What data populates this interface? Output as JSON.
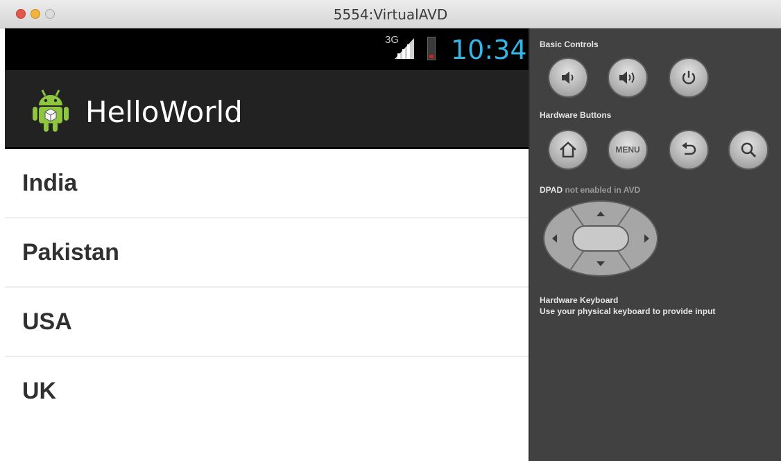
{
  "window": {
    "title": "5554:VirtualAVD"
  },
  "status_bar": {
    "network": "3G",
    "time": "10:34",
    "time_color": "#33b5e5",
    "battery_level": 0.15
  },
  "action_bar": {
    "app_title": "HelloWorld",
    "icon": "android-robot-icon"
  },
  "list": {
    "items": [
      "India",
      "Pakistan",
      "USA",
      "UK"
    ]
  },
  "controls": {
    "basic_label": "Basic Controls",
    "basic_buttons": [
      "volume-down-icon",
      "volume-up-icon",
      "power-icon"
    ],
    "hardware_label": "Hardware Buttons",
    "hardware_buttons": [
      "home-icon",
      "menu",
      "back-icon",
      "search-icon"
    ],
    "menu_label": "MENU",
    "dpad_label_strong": "DPAD",
    "dpad_label_dim": "not enabled in AVD",
    "keyboard_title": "Hardware Keyboard",
    "keyboard_desc": "Use your physical keyboard to provide input"
  }
}
